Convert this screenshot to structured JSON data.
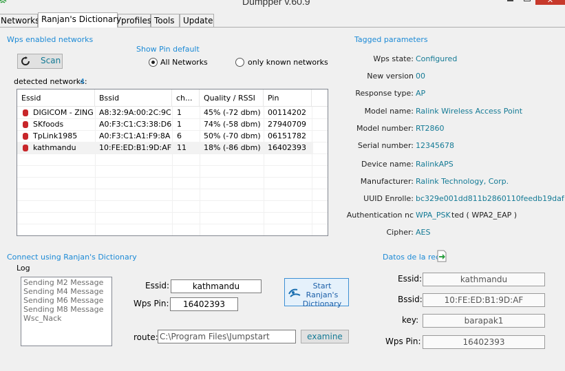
{
  "window": {
    "title": "Dumpper v.60.9",
    "close_glyph": "✕"
  },
  "tabs": [
    {
      "label": "Networks",
      "active": false
    },
    {
      "label": "Ranjan's Dictionary",
      "active": true
    },
    {
      "label": "profiles",
      "active": false
    },
    {
      "label": "Tools",
      "active": false
    },
    {
      "label": "Update",
      "active": false
    }
  ],
  "wps": {
    "section_title": "Wps enabled networks",
    "scan_label": "Scan",
    "show_pin_title": "Show Pin default",
    "radio_all": "All Networks",
    "radio_known": "only known networks",
    "detected_label": "detected networks:",
    "detected_count": "4",
    "columns": [
      "Essid",
      "Bssid",
      "ch...",
      "Quality / RSSI",
      "Pin"
    ],
    "rows": [
      {
        "essid": "DIGICOM - ZING",
        "bssid": "A8:32:9A:00:2C:9C",
        "ch": "1",
        "quality": "45% (-72 dbm)",
        "pin": "00114202"
      },
      {
        "essid": "SKfoods",
        "bssid": "A0:F3:C1:C3:38:D6",
        "ch": "1",
        "quality": "74% (-58 dbm)",
        "pin": "27940709"
      },
      {
        "essid": "TpLink1985",
        "bssid": "A0:F3:C1:A1:F9:8A",
        "ch": "6",
        "quality": "50% (-70 dbm)",
        "pin": "06151782"
      },
      {
        "essid": "kathmandu",
        "bssid": "10:FE:ED:B1:9D:AF",
        "ch": "11",
        "quality": "18% (-86 dbm)",
        "pin": "16402393"
      }
    ]
  },
  "tagged": {
    "title": "Tagged parameters",
    "items": [
      {
        "label": "Wps state:",
        "value": "Configured"
      },
      {
        "label": "New version",
        "value": "00"
      },
      {
        "label": "Response type:",
        "value": "AP"
      },
      {
        "label": "Model name:",
        "value": "Ralink Wireless Access Point"
      },
      {
        "label": "Model number:",
        "value": "RT2860"
      },
      {
        "label": "Serial number:",
        "value": "12345678"
      },
      {
        "label": "Device name:",
        "value": "RalinkAPS"
      },
      {
        "label": "Manufacturer:",
        "value": "Ralink Technology, Corp."
      },
      {
        "label": "UUID Enrolle:",
        "value": "bc329e001dd811b2860110feedb19daf"
      },
      {
        "label": "Authentication nc",
        "value": "WPA_PSK",
        "extra": "ted ( WPA2_EAP )"
      },
      {
        "label": "Cipher:",
        "value": "AES"
      }
    ]
  },
  "connect": {
    "title": "Connect using Ranjan's Dictionary",
    "log_label": "Log",
    "log_lines": [
      "Sending M2 Message",
      "Sending M4 Message",
      "Sending M6 Message",
      "Sending M8 Message",
      "Wsc_Nack"
    ],
    "essid_label": "Essid:",
    "essid_value": "kathmandu",
    "pin_label": "Wps Pin:",
    "pin_value": "16402393",
    "start_line1": "Start Ranjan's",
    "start_line2": "Dictionary",
    "route_label": "route:",
    "route_value": "C:\\Program Files\\Jumpstart",
    "examine_label": "examine"
  },
  "datos": {
    "title": "Datos de la red",
    "essid_label": "Essid:",
    "essid_value": "kathmandu",
    "bssid_label": "Bssid:",
    "bssid_value": "10:FE:ED:B1:9D:AF",
    "key_label": "key:",
    "key_value": "barapak1",
    "pin_label": "Wps Pin:",
    "pin_value": "16402393"
  },
  "colors": {
    "accent": "#1c8ad6",
    "value_teal": "#147a95",
    "close_red": "#c7392b",
    "db_red": "#c8262a"
  }
}
